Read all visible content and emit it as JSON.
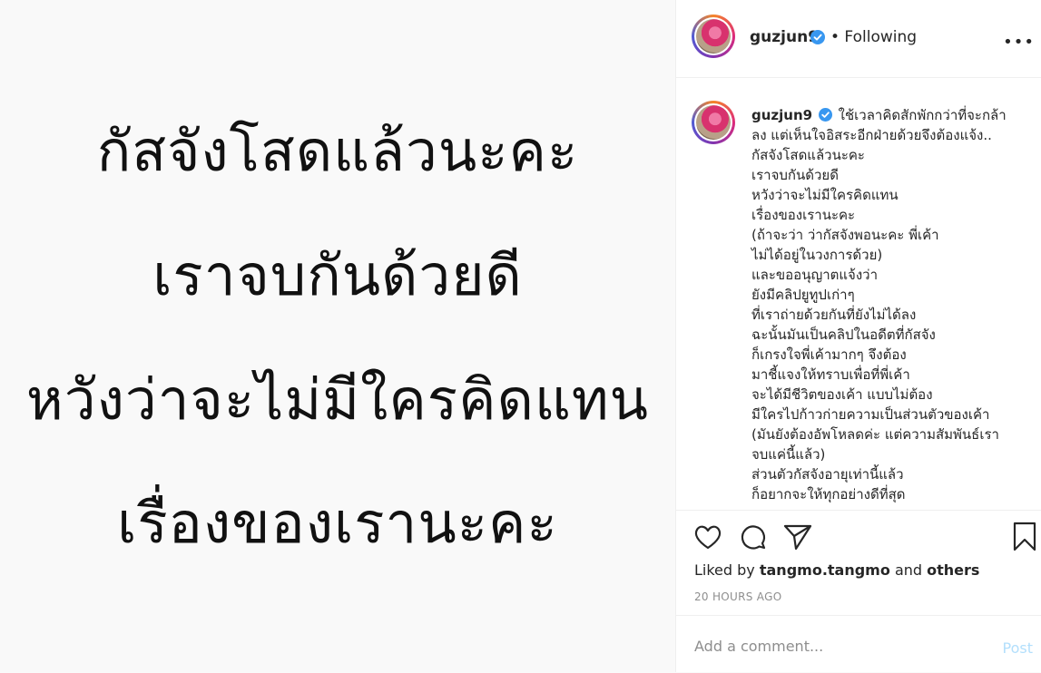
{
  "image_text": {
    "lines": [
      "กัสจังโสดแล้วนะคะ",
      "เราจบกันด้วยดี",
      "หวังว่าจะไม่มีใครคิดแทน",
      "เรื่องของเรานะคะ"
    ]
  },
  "header": {
    "username": "guzjun9",
    "following_label": "• Following",
    "more_label": "•••"
  },
  "caption": {
    "username": "guzjun9",
    "first_line": "ใช้เวลาคิดสักพักกว่าที่จะกล้า",
    "lines": [
      "ลง แต่เห็นใจอิสระอีกฝ่ายด้วยจึงต้องแจ้ง..",
      "กัสจังโสดแล้วนะคะ",
      "เราจบกันด้วยดี",
      "หวังว่าจะไม่มีใครคิดแทน",
      "เรื่องของเรานะคะ",
      "(ถ้าจะว่า ว่ากัสจังพอนะคะ พี่เค้า",
      "ไม่ได้อยู่ในวงการด้วย)",
      "และขออนุญาตแจ้งว่า",
      "ยังมีคลิปยูทูปเก่าๆ",
      "ที่เราถ่ายด้วยกันที่ยังไม่ได้ลง",
      "ฉะนั้นมันเป็นคลิปในอดีตที่กัสจัง",
      "ก็เกรงใจพี่เค้ามากๆ จึงต้อง",
      "มาชี้แจงให้ทราบเพื่อที่พี่เค้า",
      "จะได้มีชีวิตของเค้า แบบไม่ต้อง",
      "มีใครไปก้าวก่ายความเป็นส่วนตัวของเค้า",
      "(มันยังต้องอัพโหลดค่ะ แต่ความสัมพันธ์เรา",
      "จบแค่นี้แล้ว)",
      "ส่วนตัวกัสจังอายุเท่านี้แล้ว",
      "ก็อยากจะให้ทุกอย่างดีที่สุด"
    ]
  },
  "actions": {
    "liked_by_prefix": "Liked by",
    "liked_by_user": "tangmo.tangmo",
    "and_text": "and",
    "others_text": "others",
    "timestamp": "20 HOURS AGO"
  },
  "comment": {
    "placeholder": "Add a comment...",
    "post_label": "Post"
  },
  "colors": {
    "verified": "#3897f0",
    "post_disabled": "#b2dffc",
    "muted": "#8e8e8e"
  }
}
